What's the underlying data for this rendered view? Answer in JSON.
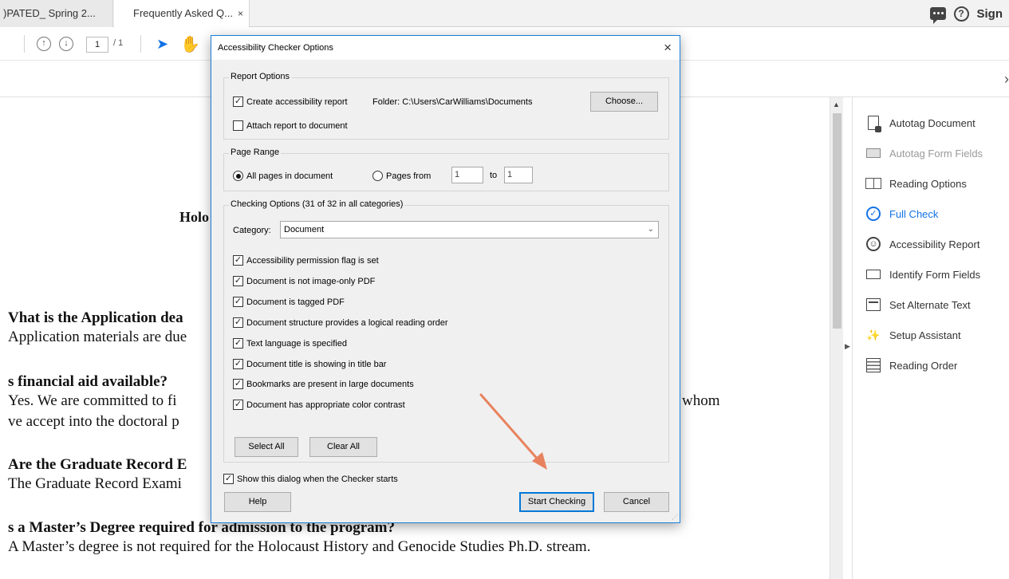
{
  "tabs": [
    {
      "label": ")PATED_ Spring 2..."
    },
    {
      "label": "Frequently Asked Q...",
      "close": "×"
    }
  ],
  "topright": {
    "sign_label": "Sign",
    "help_glyph": "?"
  },
  "toolbar": {
    "page_current": "1",
    "page_total": "/ 1"
  },
  "document": {
    "title_fragment": "Holo",
    "lines": [
      {
        "kind": "q",
        "text": "Vhat is the Application dea"
      },
      {
        "kind": "a",
        "text": "Application materials are due"
      },
      {
        "kind": "q",
        "text": "s financial aid available?"
      },
      {
        "kind": "a",
        "text": "Yes.  We are committed to fi"
      },
      {
        "kind": "a",
        "text": "ve accept into the doctoral p"
      },
      {
        "kind": "a",
        "text": "whom"
      },
      {
        "kind": "q",
        "text": "Are the Graduate Record E"
      },
      {
        "kind": "a",
        "text": "The Graduate Record Exami"
      },
      {
        "kind": "q",
        "text": "s a Master’s Degree required for admission to the program?"
      },
      {
        "kind": "a",
        "text": "A Master’s degree is not required for the Holocaust History and Genocide Studies Ph.D. stream."
      }
    ]
  },
  "right_panel": {
    "items": [
      {
        "label": "Autotag Document",
        "icon": "autotag-document-icon",
        "state": "normal"
      },
      {
        "label": "Autotag Form Fields",
        "icon": "autotag-form-fields-icon",
        "state": "disabled"
      },
      {
        "label": "Reading Options",
        "icon": "reading-options-icon",
        "state": "normal"
      },
      {
        "label": "Full Check",
        "icon": "full-check-icon",
        "state": "active"
      },
      {
        "label": "Accessibility Report",
        "icon": "accessibility-report-icon",
        "state": "normal"
      },
      {
        "label": "Identify Form Fields",
        "icon": "identify-form-fields-icon",
        "state": "normal"
      },
      {
        "label": "Set Alternate Text",
        "icon": "set-alternate-text-icon",
        "state": "normal"
      },
      {
        "label": "Setup Assistant",
        "icon": "setup-assistant-icon",
        "state": "normal"
      },
      {
        "label": "Reading Order",
        "icon": "reading-order-icon",
        "state": "normal"
      }
    ],
    "active_color": "#1473e6"
  },
  "dialog": {
    "title": "Accessibility Checker Options",
    "close": "×",
    "report_options": {
      "legend": "Report Options",
      "create_report": {
        "label": "Create accessibility report",
        "checked": true
      },
      "folder": "Folder: C:\\Users\\CarWilliams\\Documents",
      "choose": "Choose...",
      "attach_report": {
        "label": "Attach report to document",
        "checked": false
      }
    },
    "page_range": {
      "legend": "Page Range",
      "all_pages": {
        "label": "All pages in document",
        "selected": true
      },
      "pages_from": {
        "label": "Pages from",
        "selected": false
      },
      "from_value": "1",
      "to_label": "to",
      "to_value": "1"
    },
    "checking_options": {
      "legend": "Checking Options (31 of 32 in all categories)",
      "category_label": "Category:",
      "category_value": "Document",
      "checks": [
        {
          "label": "Accessibility permission flag is set",
          "checked": true
        },
        {
          "label": "Document is not image-only PDF",
          "checked": true
        },
        {
          "label": "Document is tagged PDF",
          "checked": true
        },
        {
          "label": "Document structure provides a logical reading order",
          "checked": true
        },
        {
          "label": "Text language is specified",
          "checked": true
        },
        {
          "label": "Document title is showing in title bar",
          "checked": true
        },
        {
          "label": "Bookmarks are present in large documents",
          "checked": true
        },
        {
          "label": "Document has appropriate color contrast",
          "checked": true
        }
      ],
      "select_all": "Select All",
      "clear_all": "Clear All"
    },
    "show_dialog": {
      "label": "Show this dialog when the Checker starts",
      "checked": true
    },
    "help": "Help",
    "start_checking": "Start Checking",
    "cancel": "Cancel"
  },
  "annotation_color": "#e8825e"
}
